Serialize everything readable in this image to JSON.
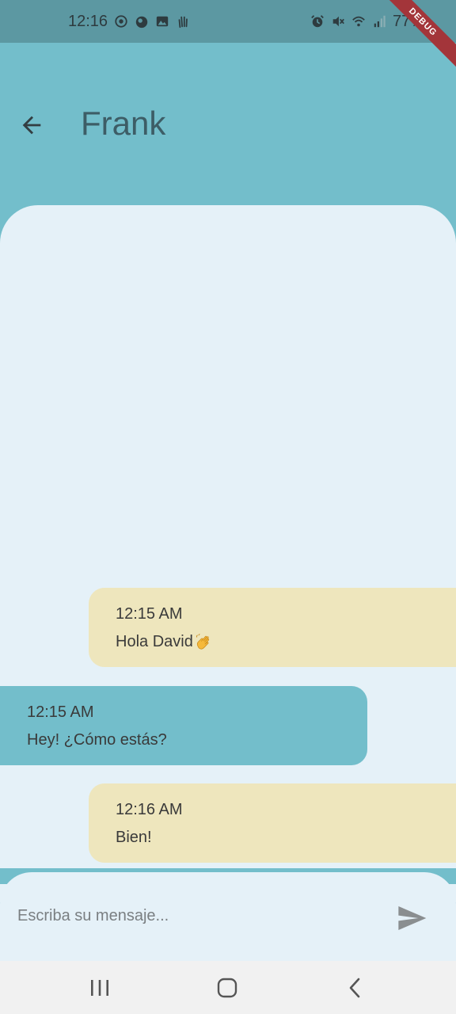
{
  "status_bar": {
    "time": "12:16",
    "battery": "77%",
    "left_icons": [
      "sync-icon",
      "firefox-icon",
      "image-icon",
      "hand-icon"
    ],
    "right_icons": [
      "alarm-icon",
      "mute-icon",
      "wifi-icon",
      "signal-icon"
    ]
  },
  "debug_banner": "DEBUG",
  "header": {
    "title": "Frank",
    "back_icon": "arrow-back-icon"
  },
  "messages": [
    {
      "direction": "outgoing",
      "time": "12:15 AM",
      "text": "Hola David",
      "emoji": "waving-hand-icon"
    },
    {
      "direction": "incoming",
      "time": "12:15 AM",
      "text": "Hey! ¿Cómo estás?"
    },
    {
      "direction": "outgoing",
      "time": "12:16 AM",
      "text": "Bien!"
    }
  ],
  "composer": {
    "placeholder": "Escriba su mensaje...",
    "value": "",
    "send_icon": "send-icon"
  },
  "nav_bar": {
    "icons": [
      "recents-icon",
      "home-icon",
      "back-nav-icon"
    ]
  },
  "colors": {
    "app_bar": "#73BECB",
    "status_bar": "#5C98A2",
    "chat_background": "#E5F1F8",
    "outgoing_bubble": "#EEE6BD",
    "incoming_bubble": "#73BECB",
    "title_text": "#3D5D66",
    "debug_ribbon": "#A3353A"
  }
}
